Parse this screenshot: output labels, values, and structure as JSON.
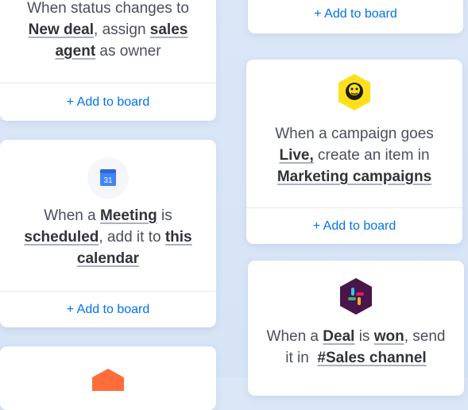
{
  "cards": [
    {
      "id": "status-card",
      "line1": "When status changes to",
      "line2_bold1": "New deal",
      "line2_text": ", assign ",
      "line2_bold2": "sales",
      "line3_bold": "agent",
      "line3_text": " as owner",
      "add_label": "+ Add to board"
    },
    {
      "id": "top-right-card",
      "add_label": "+ Add to board"
    },
    {
      "id": "calendar-card",
      "icon": "google-calendar-icon",
      "icon_text": "31",
      "line1_text": "When a ",
      "line1_bold": "Meeting",
      "line1_tail": " is",
      "line2_bold1": "scheduled",
      "line2_text": ", add it to ",
      "line2_bold2": "this",
      "line3_bold": "calendar",
      "add_label": "+ Add to board"
    },
    {
      "id": "mailchimp-card",
      "icon": "mailchimp-icon",
      "line1": "When a campaign goes",
      "line2_bold": "Live,",
      "line2_text": " create an item in",
      "line3_bold": "Marketing campaigns",
      "add_label": "+ Add to board"
    },
    {
      "id": "slack-card",
      "icon": "slack-icon",
      "line1_text": "When a ",
      "line1_bold1": "Deal",
      "line1_mid": " is ",
      "line1_bold2": "won",
      "line1_tail": ", send",
      "line2_text": "it in  ",
      "line2_bold": "#Sales channel"
    },
    {
      "id": "bottom-left-card",
      "icon": "orange-hexagon-icon"
    }
  ],
  "colors": {
    "link": "#0073ea",
    "calendar_blue": "#4285f4",
    "mailchimp_yellow": "#ffe01b",
    "slack_purple": "#4a154b",
    "hex_orange": "#ff6d3b"
  }
}
